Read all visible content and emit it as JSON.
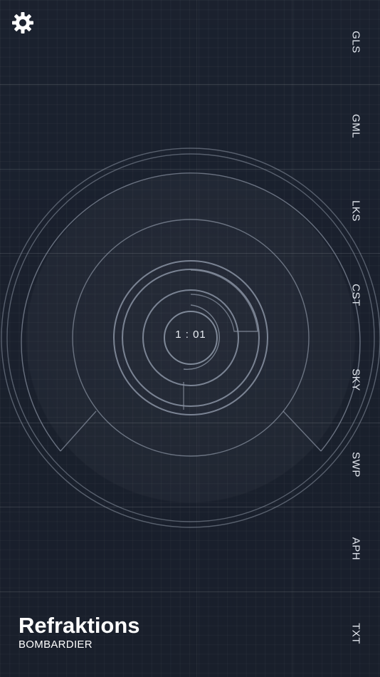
{
  "app": {
    "title": "Refraktions",
    "subtitle": "BOMBARDIER"
  },
  "timer": {
    "value": "1 : 01"
  },
  "nav": {
    "items": [
      {
        "label": "GLS"
      },
      {
        "label": "GML"
      },
      {
        "label": "LKS"
      },
      {
        "label": "CST"
      },
      {
        "label": "SKY"
      },
      {
        "label": "SWP"
      },
      {
        "label": "APH"
      },
      {
        "label": "TXT"
      }
    ]
  },
  "icons": {
    "settings": "gear-icon"
  },
  "colors": {
    "background": "#1c2331",
    "line": "#8a93a3",
    "text": "#e4e8ef"
  }
}
